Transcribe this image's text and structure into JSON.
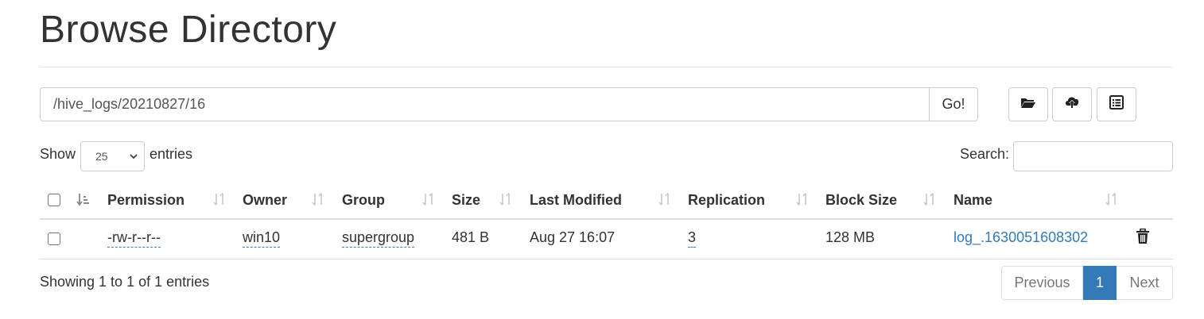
{
  "page": {
    "title": "Browse Directory"
  },
  "path": {
    "value": "/hive_logs/20210827/16",
    "go_label": "Go!"
  },
  "toolbar": {
    "icons": [
      "folder-open-icon",
      "cloud-upload-icon",
      "list-alt-icon"
    ]
  },
  "length": {
    "show_label": "Show",
    "value": "25",
    "entries_label": "entries"
  },
  "search": {
    "label": "Search:",
    "value": ""
  },
  "table": {
    "headers": [
      "Permission",
      "Owner",
      "Group",
      "Size",
      "Last Modified",
      "Replication",
      "Block Size",
      "Name"
    ],
    "rows": [
      {
        "permission": "-rw-r--r--",
        "owner": "win10",
        "group": "supergroup",
        "size": "481 B",
        "last_modified": "Aug 27 16:07",
        "replication": "3",
        "block_size": "128 MB",
        "name": "log_.1630051608302"
      }
    ]
  },
  "footer": {
    "info": "Showing 1 to 1 of 1 entries"
  },
  "pagination": {
    "previous": "Previous",
    "current": "1",
    "next": "Next"
  },
  "colors": {
    "accent": "#337ab7",
    "border": "#cccccc",
    "text": "#333333"
  }
}
